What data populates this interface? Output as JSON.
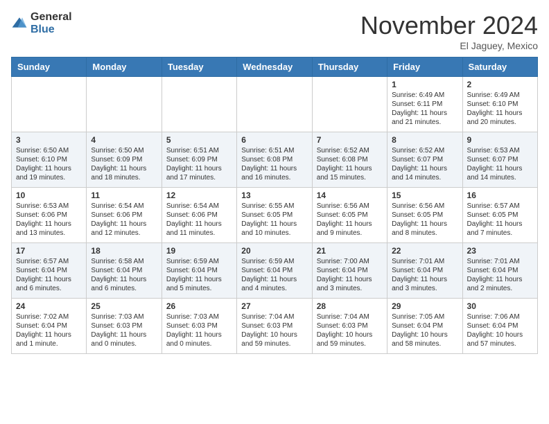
{
  "header": {
    "logo_general": "General",
    "logo_blue": "Blue",
    "month_title": "November 2024",
    "location": "El Jaguey, Mexico"
  },
  "weekdays": [
    "Sunday",
    "Monday",
    "Tuesday",
    "Wednesday",
    "Thursday",
    "Friday",
    "Saturday"
  ],
  "rows": [
    [
      {
        "day": "",
        "info": ""
      },
      {
        "day": "",
        "info": ""
      },
      {
        "day": "",
        "info": ""
      },
      {
        "day": "",
        "info": ""
      },
      {
        "day": "",
        "info": ""
      },
      {
        "day": "1",
        "info": "Sunrise: 6:49 AM\nSunset: 6:11 PM\nDaylight: 11 hours and 21 minutes."
      },
      {
        "day": "2",
        "info": "Sunrise: 6:49 AM\nSunset: 6:10 PM\nDaylight: 11 hours and 20 minutes."
      }
    ],
    [
      {
        "day": "3",
        "info": "Sunrise: 6:50 AM\nSunset: 6:10 PM\nDaylight: 11 hours and 19 minutes."
      },
      {
        "day": "4",
        "info": "Sunrise: 6:50 AM\nSunset: 6:09 PM\nDaylight: 11 hours and 18 minutes."
      },
      {
        "day": "5",
        "info": "Sunrise: 6:51 AM\nSunset: 6:09 PM\nDaylight: 11 hours and 17 minutes."
      },
      {
        "day": "6",
        "info": "Sunrise: 6:51 AM\nSunset: 6:08 PM\nDaylight: 11 hours and 16 minutes."
      },
      {
        "day": "7",
        "info": "Sunrise: 6:52 AM\nSunset: 6:08 PM\nDaylight: 11 hours and 15 minutes."
      },
      {
        "day": "8",
        "info": "Sunrise: 6:52 AM\nSunset: 6:07 PM\nDaylight: 11 hours and 14 minutes."
      },
      {
        "day": "9",
        "info": "Sunrise: 6:53 AM\nSunset: 6:07 PM\nDaylight: 11 hours and 14 minutes."
      }
    ],
    [
      {
        "day": "10",
        "info": "Sunrise: 6:53 AM\nSunset: 6:06 PM\nDaylight: 11 hours and 13 minutes."
      },
      {
        "day": "11",
        "info": "Sunrise: 6:54 AM\nSunset: 6:06 PM\nDaylight: 11 hours and 12 minutes."
      },
      {
        "day": "12",
        "info": "Sunrise: 6:54 AM\nSunset: 6:06 PM\nDaylight: 11 hours and 11 minutes."
      },
      {
        "day": "13",
        "info": "Sunrise: 6:55 AM\nSunset: 6:05 PM\nDaylight: 11 hours and 10 minutes."
      },
      {
        "day": "14",
        "info": "Sunrise: 6:56 AM\nSunset: 6:05 PM\nDaylight: 11 hours and 9 minutes."
      },
      {
        "day": "15",
        "info": "Sunrise: 6:56 AM\nSunset: 6:05 PM\nDaylight: 11 hours and 8 minutes."
      },
      {
        "day": "16",
        "info": "Sunrise: 6:57 AM\nSunset: 6:05 PM\nDaylight: 11 hours and 7 minutes."
      }
    ],
    [
      {
        "day": "17",
        "info": "Sunrise: 6:57 AM\nSunset: 6:04 PM\nDaylight: 11 hours and 6 minutes."
      },
      {
        "day": "18",
        "info": "Sunrise: 6:58 AM\nSunset: 6:04 PM\nDaylight: 11 hours and 6 minutes."
      },
      {
        "day": "19",
        "info": "Sunrise: 6:59 AM\nSunset: 6:04 PM\nDaylight: 11 hours and 5 minutes."
      },
      {
        "day": "20",
        "info": "Sunrise: 6:59 AM\nSunset: 6:04 PM\nDaylight: 11 hours and 4 minutes."
      },
      {
        "day": "21",
        "info": "Sunrise: 7:00 AM\nSunset: 6:04 PM\nDaylight: 11 hours and 3 minutes."
      },
      {
        "day": "22",
        "info": "Sunrise: 7:01 AM\nSunset: 6:04 PM\nDaylight: 11 hours and 3 minutes."
      },
      {
        "day": "23",
        "info": "Sunrise: 7:01 AM\nSunset: 6:04 PM\nDaylight: 11 hours and 2 minutes."
      }
    ],
    [
      {
        "day": "24",
        "info": "Sunrise: 7:02 AM\nSunset: 6:04 PM\nDaylight: 11 hours and 1 minute."
      },
      {
        "day": "25",
        "info": "Sunrise: 7:03 AM\nSunset: 6:03 PM\nDaylight: 11 hours and 0 minutes."
      },
      {
        "day": "26",
        "info": "Sunrise: 7:03 AM\nSunset: 6:03 PM\nDaylight: 11 hours and 0 minutes."
      },
      {
        "day": "27",
        "info": "Sunrise: 7:04 AM\nSunset: 6:03 PM\nDaylight: 10 hours and 59 minutes."
      },
      {
        "day": "28",
        "info": "Sunrise: 7:04 AM\nSunset: 6:03 PM\nDaylight: 10 hours and 59 minutes."
      },
      {
        "day": "29",
        "info": "Sunrise: 7:05 AM\nSunset: 6:04 PM\nDaylight: 10 hours and 58 minutes."
      },
      {
        "day": "30",
        "info": "Sunrise: 7:06 AM\nSunset: 6:04 PM\nDaylight: 10 hours and 57 minutes."
      }
    ]
  ]
}
